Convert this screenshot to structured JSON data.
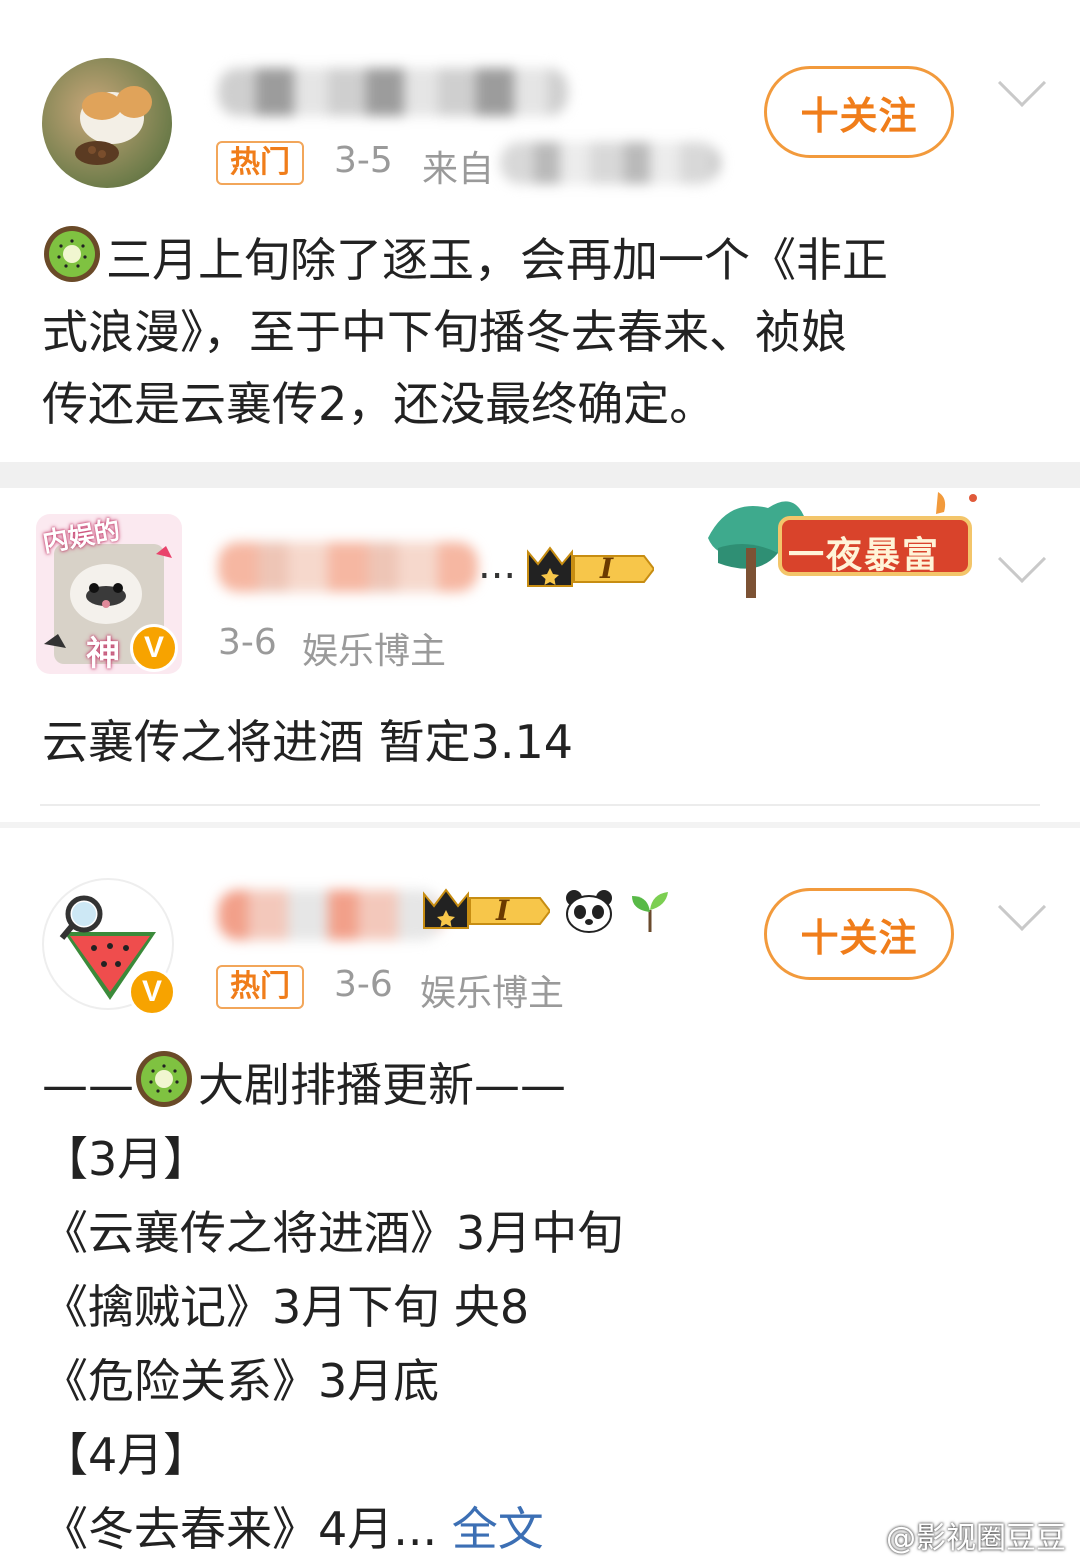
{
  "posts": [
    {
      "tag": "热门",
      "date": "3-5",
      "source_prefix": "来自",
      "follow_label": "十关注",
      "content_lines": [
        "三月上旬除了逐玉，会再加一个《非正",
        "式浪漫》，至于中下旬播冬去春来、祯娘",
        "传还是云襄传2，还没最终确定。"
      ]
    },
    {
      "date": "3-6",
      "role": "娱乐博主",
      "avatar_text_top": "内娱的",
      "avatar_text_bottom": "神",
      "vip_level": "I",
      "banner_text": "一夜暴富",
      "name_suffix": "...",
      "content": "云襄传之将进酒 暂定3.14"
    },
    {
      "tag": "热门",
      "date": "3-6",
      "role": "娱乐博主",
      "vip_level": "I",
      "follow_label": "十关注",
      "content_lines": [
        "——",
        "大剧排播更新——",
        "【3月】",
        "《云襄传之将进酒》3月中旬",
        "《擒贼记》3月下旬 央8",
        "《危险关系》3月底",
        "【4月】",
        "《冬去春来》4月..."
      ],
      "more_label": "全文"
    }
  ],
  "watermark": "@影视圈豆豆",
  "colors": {
    "accent": "#f07d1a",
    "link": "#3c6fb4",
    "meta": "#9a9a9a"
  },
  "icons": [
    "chevron-down-icon",
    "kiwi-emoji-icon",
    "crown-icon",
    "verified-v-icon",
    "panda-icon",
    "sprout-icon",
    "weibo-logo-icon"
  ]
}
